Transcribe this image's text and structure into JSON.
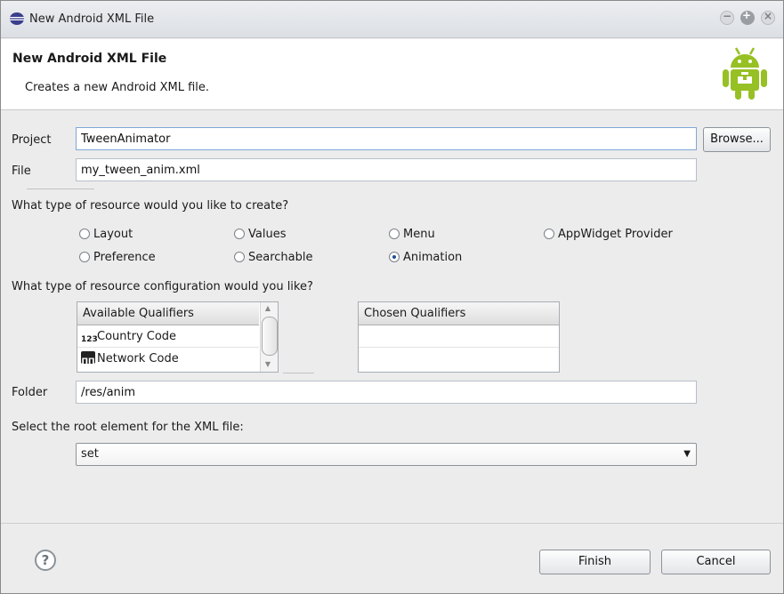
{
  "window": {
    "title": "New Android XML File",
    "controls": {
      "minimize": "−",
      "maximize": "+",
      "close": "×"
    }
  },
  "banner": {
    "title": "New Android XML File",
    "description": "Creates a new Android XML file."
  },
  "form": {
    "project_label": "Project",
    "project_value": "TweenAnimator",
    "browse_label": "Browse...",
    "file_label": "File",
    "file_value": "my_tween_anim.xml",
    "resource_type_question": "What type of resource would you like to create?",
    "resource_types": [
      {
        "label": "Layout",
        "selected": false
      },
      {
        "label": "Values",
        "selected": false
      },
      {
        "label": "Menu",
        "selected": false
      },
      {
        "label": "AppWidget Provider",
        "selected": false
      },
      {
        "label": "Preference",
        "selected": false
      },
      {
        "label": "Searchable",
        "selected": false
      },
      {
        "label": "Animation",
        "selected": true
      }
    ],
    "config_question": "What type of resource configuration would you like?",
    "available_qualifiers_header": "Available Qualifiers",
    "available_qualifiers": [
      {
        "label": "Country Code",
        "icon": "country-code-icon",
        "icon_text": "123"
      },
      {
        "label": "Network Code",
        "icon": "network-code-icon",
        "icon_text": "ΠΠ"
      }
    ],
    "chosen_qualifiers_header": "Chosen Qualifiers",
    "folder_label": "Folder",
    "folder_value": "/res/anim",
    "root_element_question": "Select the root element for the XML file:",
    "root_element_value": "set"
  },
  "footer": {
    "help_symbol": "?",
    "finish_label": "Finish",
    "cancel_label": "Cancel"
  },
  "colors": {
    "android_green": "#97c024",
    "selected_radio": "#1d4f91"
  }
}
